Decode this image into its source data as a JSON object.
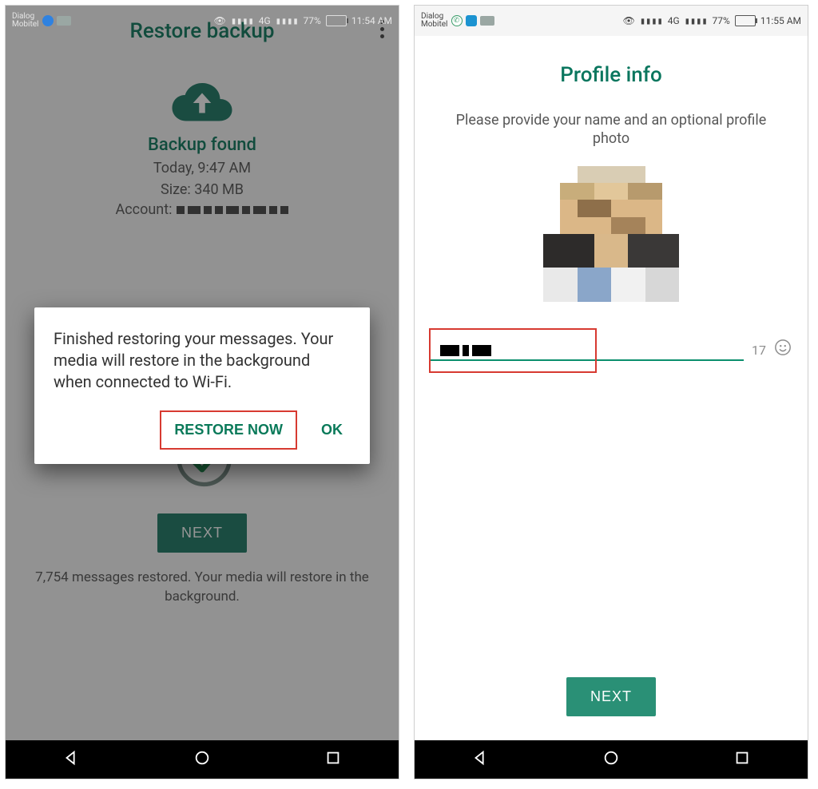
{
  "status": {
    "carrier_line1": "Dialog",
    "carrier_line2": "Mobitel",
    "battery_pct": "77%",
    "time_left": "11:54 AM",
    "time_right": "11:55 AM",
    "signal_text": "4G"
  },
  "screen1": {
    "header_title": "Restore backup",
    "backup_found": "Backup found",
    "backup_time": "Today, 9:47 AM",
    "backup_size": "Size: 340 MB",
    "account_label": "Account:",
    "dialog_msg": "Finished restoring your messages. Your media will restore in the background when connected to Wi-Fi.",
    "restore_now": "RESTORE NOW",
    "ok": "OK",
    "next": "NEXT",
    "restored_summary": "7,754 messages restored. Your media will restore in the background."
  },
  "screen2": {
    "title": "Profile info",
    "instruction": "Please provide your name and an optional profile photo",
    "char_count": "17",
    "next": "NEXT"
  },
  "colors": {
    "teal": "#107b5f",
    "teal_dark": "#1f7a66",
    "red_highlight": "#d73a31"
  }
}
